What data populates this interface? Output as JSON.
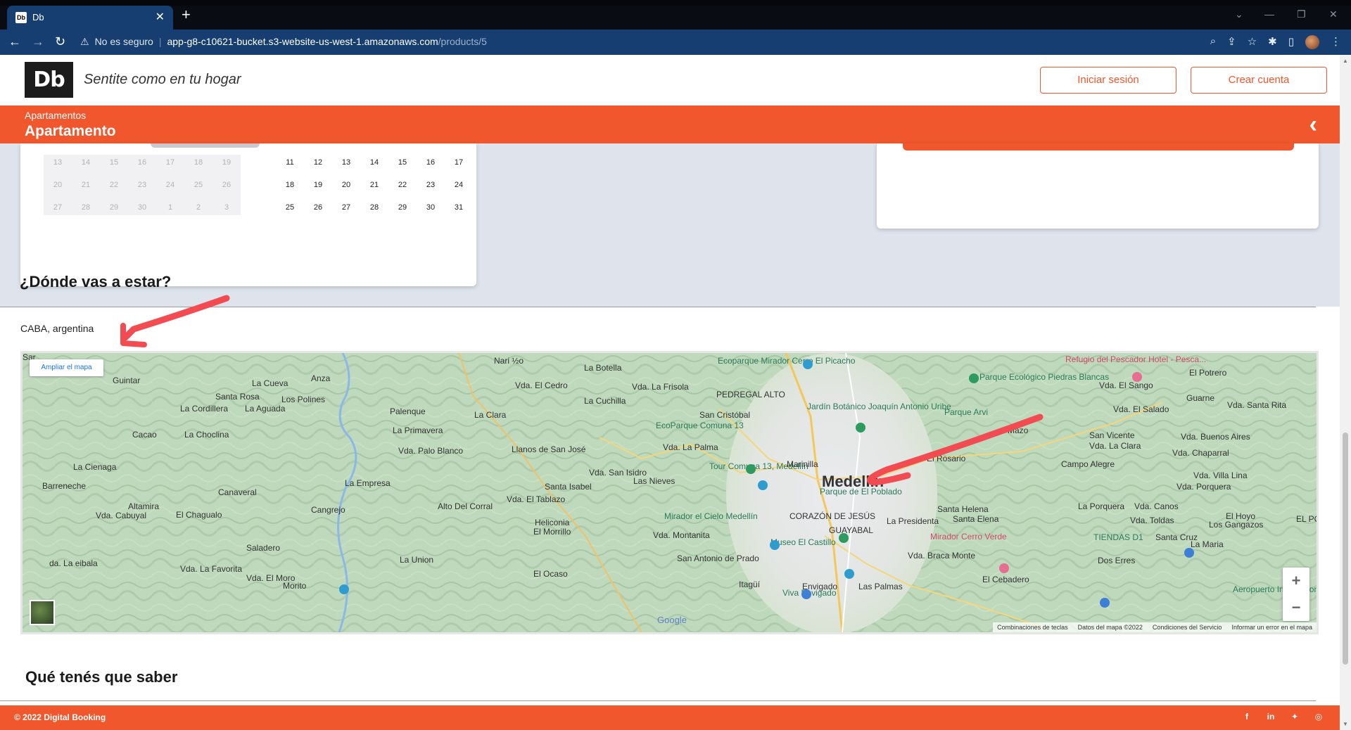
{
  "browser": {
    "tab_title": "Db",
    "tab_favicon": "Db",
    "security_warning": "No es seguro",
    "url_host": "app-g8-c10621-bucket.s3-website-us-west-1.amazonaws.com",
    "url_path": "/products/5"
  },
  "header": {
    "logo": "Db",
    "tagline": "Sentite como en tu hogar",
    "login_button": "Iniciar sesión",
    "signup_button": "Crear cuenta"
  },
  "category_bar": {
    "category": "Apartamentos",
    "title": "Apartamento"
  },
  "calendar": {
    "prev_month_days": [
      [
        "13",
        "14",
        "15",
        "16",
        "17",
        "18",
        "19"
      ],
      [
        "20",
        "21",
        "22",
        "23",
        "24",
        "25",
        "26"
      ],
      [
        "27",
        "28",
        "29",
        "30",
        "1",
        "2",
        "3"
      ]
    ],
    "current_month_days": [
      [
        "11",
        "12",
        "13",
        "14",
        "15",
        "16",
        "17"
      ],
      [
        "18",
        "19",
        "20",
        "21",
        "22",
        "23",
        "24"
      ],
      [
        "25",
        "26",
        "27",
        "28",
        "29",
        "30",
        "31"
      ]
    ]
  },
  "location_section": {
    "heading": "¿Dónde vas a estar?",
    "location": "CABA, argentina"
  },
  "map": {
    "expand_button": "Ampliar el mapa",
    "city_label": "Medellín",
    "labels": [
      "Nari ½o",
      "La Botella",
      "Vda. El Cedro",
      "Vda. La Frisola",
      "La Cuchilla",
      "Guintar",
      "La Cueva",
      "Anza",
      "Santa Rosa",
      "Los Polines",
      "La Cordillera",
      "La Aguada",
      "Palenque",
      "La Clara",
      "Cacao",
      "La Choclina",
      "La Primavera",
      "Vda. Palo Blanco",
      "Llanos de San José",
      "La Cienaga",
      "La Empresa",
      "Barreneche",
      "Canaveral",
      "Santa Isabel",
      "Vda. San Isidro",
      "Las Nieves",
      "Vda. El Tablazo",
      "Altamira",
      "Vda. Cabuyal",
      "El Chagualo",
      "Cangrejo",
      "Alto Del Corral",
      "Heliconia",
      "El Morrillo",
      "Vda. Montanita",
      "Saladero",
      "La Union",
      "San Antonio de Prado",
      "Vda. La Favorita",
      "Vda. El Moro",
      "El Ocaso",
      "Itagüí",
      "Envigado",
      "Las Palmas",
      "da. La eibala",
      "Morito",
      "PEDREGAL ALTO",
      "San Cristóbal",
      "Jardín Botánico Joaquín Antonio Uribe",
      "EcoParque Comuna 13",
      "Vda. La Palma",
      "Tour Comuna 13, Medellín",
      "Parque de El Poblado",
      "Mirador el Cielo Medellín",
      "Museo El Castillo",
      "Viva Envigado",
      "Ecoparque Mirador Cerro El Picacho",
      "Parque Ecológico Piedras Blancas",
      "Parque Arvi",
      "Mazo",
      "El Rosario",
      "Santa Helena",
      "Santa Elena",
      "La Presidenta",
      "Mirador Cerro Verde",
      "Vda. Braca Monte",
      "El Cebadero",
      "Refugio del Pescador Hotel - Pesca...",
      "El Potrero",
      "Vda. El Sango",
      "Vda. El Salado",
      "Guarne",
      "Vda. Santa Rita",
      "San Vicente",
      "Vda. La Clara",
      "Vda. Buenos Aires",
      "Vda. Chaparral",
      "Campo Alegre",
      "Vda. Villa Lina",
      "Vda. Porquera",
      "La Porquera",
      "Vda. Canos",
      "Vda. Toldas",
      "El Hoyo",
      "Los Gangazos",
      "Santa Cruz",
      "TIENDAS D1",
      "La Maria",
      "Dos Erres",
      "Aeropuerto Internacional José María",
      "Marinilla",
      "CORAZÓN DE JESÚS",
      "GUAYABAL",
      "EL POBLADO",
      "Sar"
    ],
    "attribution": [
      "Combinaciones de teclas",
      "Datos del mapa ©2022",
      "Condiciones del Servicio",
      "Informar un error en el mapa"
    ],
    "zoom_in": "+",
    "zoom_out": "−",
    "google": "Google"
  },
  "know_section": {
    "heading": "Qué tenés que saber"
  },
  "footer": {
    "copyright": "© 2022 Digital Booking"
  },
  "social_icons": [
    "facebook-icon",
    "linkedin-icon",
    "twitter-icon",
    "instagram-icon"
  ]
}
